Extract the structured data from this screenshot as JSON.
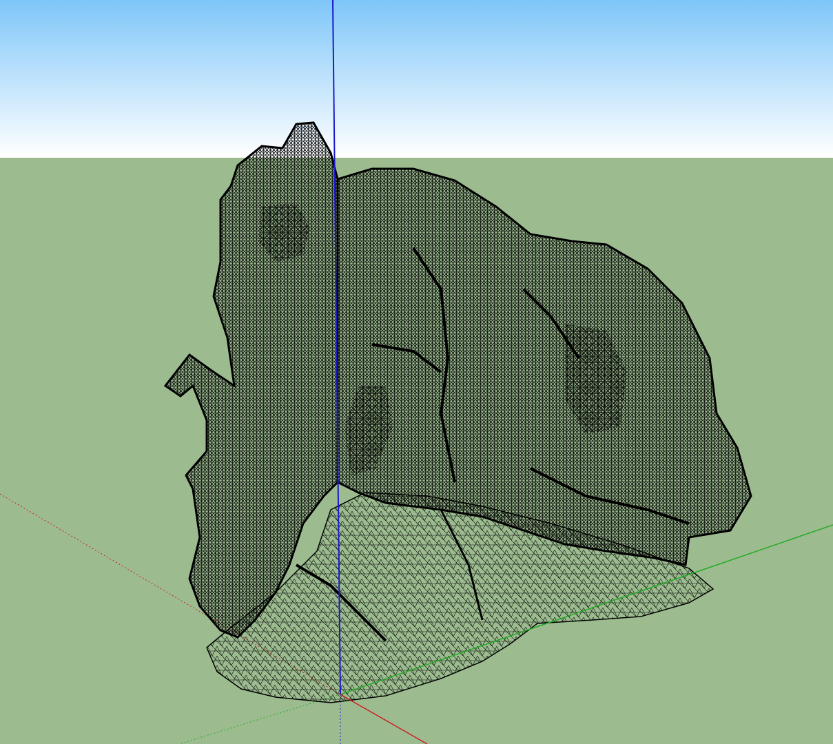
{
  "scene": {
    "sky_gradient": [
      "#7ec6f9",
      "#ffffff"
    ],
    "ground_color": "#9cbc90",
    "mesh_color": "#000000",
    "axes": {
      "red": "#cc2222",
      "green": "#22aa22",
      "blue": "#1a1acc"
    },
    "model_icon": "wireframe-rock-mesh"
  }
}
